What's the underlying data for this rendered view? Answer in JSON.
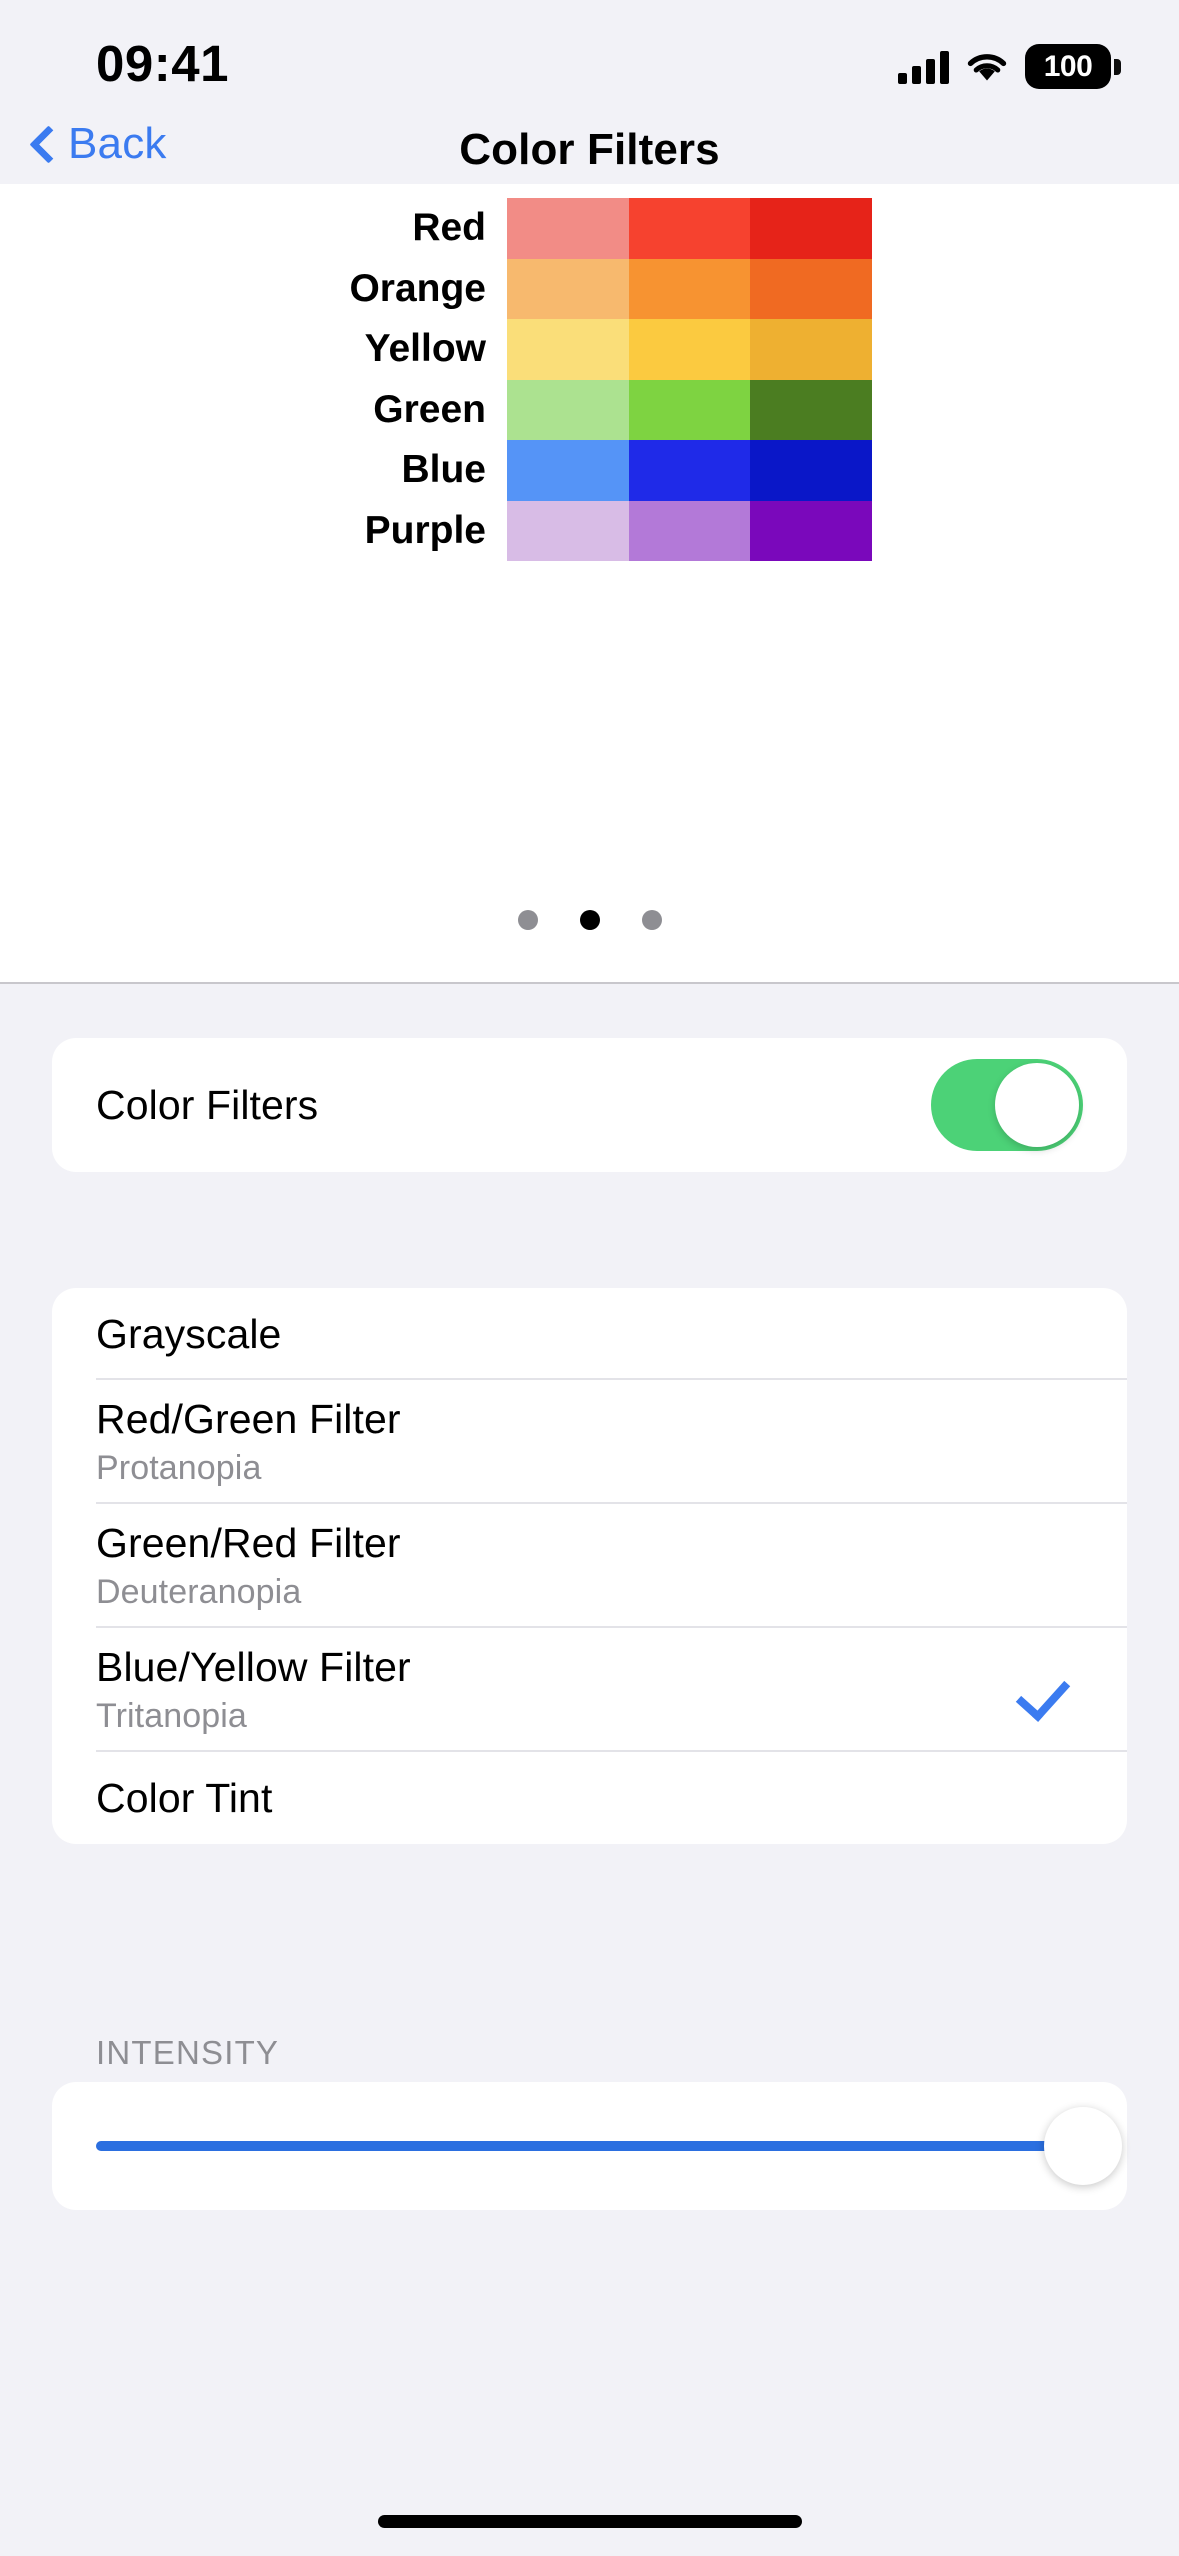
{
  "status_bar": {
    "time": "09:41",
    "signal_icon": "cellular-signal-icon",
    "wifi_icon": "wifi-icon",
    "battery_level": "100",
    "battery_icon": "battery-icon"
  },
  "nav": {
    "back_label": "Back",
    "back_icon": "chevron-left-icon",
    "title": "Color Filters"
  },
  "preview": {
    "rows": [
      {
        "label": "Red",
        "swatches": [
          "#f28c86",
          "#f6422f",
          "#e62319"
        ]
      },
      {
        "label": "Orange",
        "swatches": [
          "#f7b96e",
          "#f79331",
          "#f06a22"
        ]
      },
      {
        "label": "Yellow",
        "swatches": [
          "#fade79",
          "#fbca40",
          "#eeb031"
        ]
      },
      {
        "label": "Green",
        "swatches": [
          "#ace290",
          "#7ed341",
          "#4b7d21"
        ]
      },
      {
        "label": "Blue",
        "swatches": [
          "#5594f7",
          "#1f2ae8",
          "#0a17c8"
        ]
      },
      {
        "label": "Purple",
        "swatches": [
          "#d8bce6",
          "#b379d8",
          "#7a08bb"
        ]
      }
    ],
    "page_dots": {
      "count": 3,
      "active_index": 1
    }
  },
  "toggle_section": {
    "label": "Color Filters",
    "enabled": true,
    "on_color": "#4cd277"
  },
  "filters": {
    "items": [
      {
        "title": "Grayscale",
        "subtitle": "",
        "selected": false
      },
      {
        "title": "Red/Green Filter",
        "subtitle": "Protanopia",
        "selected": false
      },
      {
        "title": "Green/Red Filter",
        "subtitle": "Deuteranopia",
        "selected": false
      },
      {
        "title": "Blue/Yellow Filter",
        "subtitle": "Tritanopia",
        "selected": true
      },
      {
        "title": "Color Tint",
        "subtitle": "",
        "selected": false
      }
    ],
    "checkmark_icon": "checkmark-icon",
    "accent_color": "#3b7bf0"
  },
  "intensity": {
    "header": "INTENSITY",
    "value_percent": 100,
    "fill_color": "#2b6fe0"
  }
}
